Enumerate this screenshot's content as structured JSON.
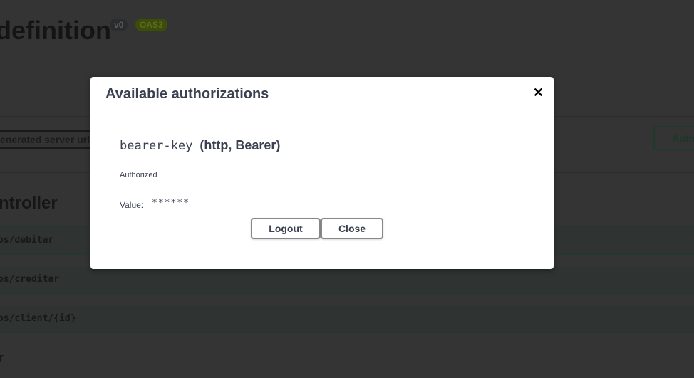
{
  "page": {
    "title": "definition",
    "version_badge": "v0",
    "oas_badge": "OAS3",
    "server_select": "enerated server url",
    "authorize_button": "Auth",
    "section_title": "ntroller",
    "operations": [
      "os/debitar",
      "os/creditar",
      "os/client/{id}"
    ],
    "trailing_text": "r"
  },
  "modal": {
    "title": "Available authorizations",
    "close_icon": "close-x-icon",
    "scheme_name": "bearer-key",
    "scheme_type": "(http, Bearer)",
    "status": "Authorized",
    "value_label": "Value:",
    "value": "******",
    "logout_label": "Logout",
    "close_label": "Close"
  }
}
